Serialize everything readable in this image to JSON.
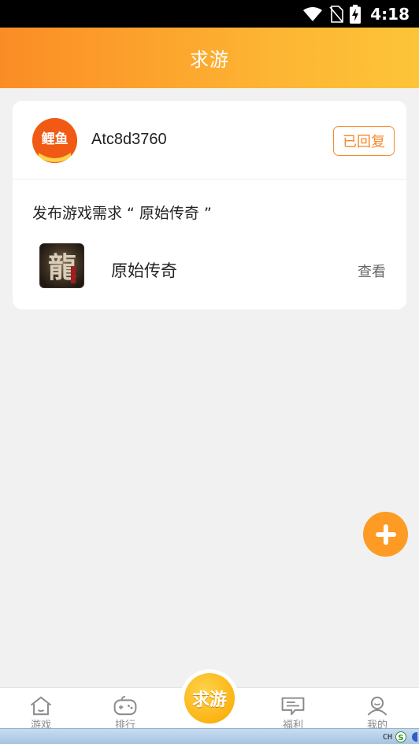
{
  "status_bar": {
    "time": "4:18"
  },
  "header": {
    "title": "求游"
  },
  "request_card": {
    "user": {
      "name": "Atc8d3760",
      "avatar_text": "鲤鱼"
    },
    "status_badge": "已回复",
    "request_text": "发布游戏需求 “ 原始传奇 ”",
    "game": {
      "icon_text": "龍",
      "name": "原始传奇",
      "view_label": "查看"
    }
  },
  "fab": {
    "icon": "plus-icon"
  },
  "bottom_nav": {
    "items": [
      {
        "label": "游戏",
        "icon": "home-icon"
      },
      {
        "label": "排行",
        "icon": "gamepad-icon"
      },
      {
        "label": "求游",
        "icon": "center-tab"
      },
      {
        "label": "福利",
        "icon": "message-icon"
      },
      {
        "label": "我的",
        "icon": "user-icon"
      }
    ]
  },
  "taskbar": {
    "lang": "CH"
  },
  "colors": {
    "accent": "#fb8c25",
    "accent_light": "#fdc438",
    "badge": "#f7892a",
    "fab": "#fd9b24",
    "background": "#f1f1f1"
  }
}
